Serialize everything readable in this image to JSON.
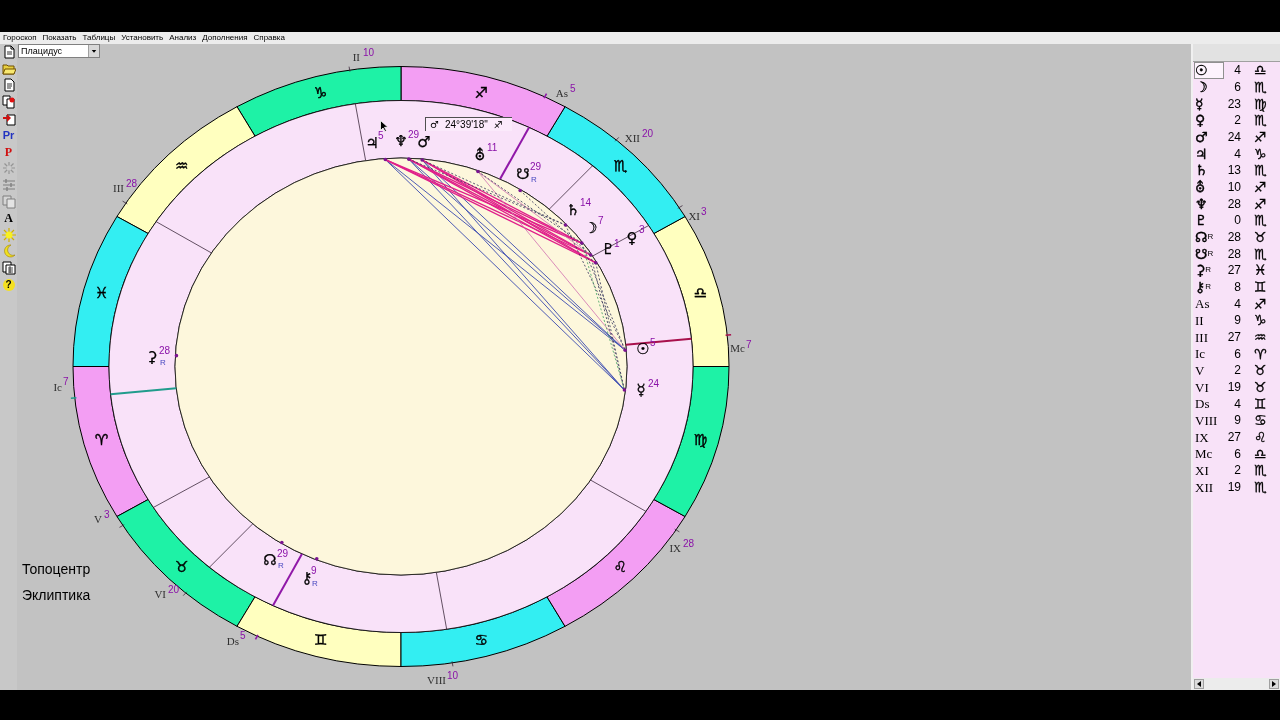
{
  "menu": [
    "Гороскоп",
    "Показать",
    "Таблицы",
    "Установить",
    "Анализ",
    "Дополнения",
    "Справка"
  ],
  "house_system": {
    "value": "Плацидус"
  },
  "toolbar": [
    {
      "kind": "icon",
      "disabled": false
    },
    {
      "kind": "icon",
      "disabled": false
    },
    {
      "kind": "icon",
      "disabled": false
    },
    {
      "kind": "icon",
      "disabled": false
    },
    {
      "kind": "icon",
      "disabled": false
    },
    {
      "kind": "text",
      "label": "Pr",
      "disabled": false
    },
    {
      "kind": "text",
      "label": "P",
      "disabled": false
    },
    {
      "kind": "icon",
      "disabled": true
    },
    {
      "kind": "icon",
      "disabled": true
    },
    {
      "kind": "icon",
      "disabled": true
    },
    {
      "kind": "text",
      "label": "A",
      "disabled": false
    },
    {
      "kind": "icon",
      "disabled": false
    },
    {
      "kind": "icon",
      "disabled": false
    },
    {
      "kind": "icon",
      "disabled": false
    },
    {
      "kind": "text",
      "label": "?",
      "disabled": false
    }
  ],
  "wheel": {
    "signs": [
      {
        "glyph": "♈",
        "color": "#f39ef3"
      },
      {
        "glyph": "♉",
        "color": "#1ef2a6"
      },
      {
        "glyph": "♊",
        "color": "#ffffbf"
      },
      {
        "glyph": "♋",
        "color": "#33eef2"
      },
      {
        "glyph": "♌",
        "color": "#f39ef3"
      },
      {
        "glyph": "♍",
        "color": "#1ef2a6"
      },
      {
        "glyph": "♎",
        "color": "#ffffbf"
      },
      {
        "glyph": "♏",
        "color": "#33eef2"
      },
      {
        "glyph": "♐",
        "color": "#f39ef3"
      },
      {
        "glyph": "♑",
        "color": "#1ef2a6"
      },
      {
        "glyph": "♒",
        "color": "#ffffbf"
      },
      {
        "glyph": "♓",
        "color": "#33eef2"
      }
    ],
    "cusps": [
      {
        "kind": "angle",
        "label": "As",
        "degree": "5",
        "color": "#9018a8"
      },
      {
        "kind": "house",
        "label": "II",
        "degree": "10"
      },
      {
        "kind": "house",
        "label": "III",
        "degree": "28"
      },
      {
        "kind": "angle",
        "label": "Ic",
        "degree": "7",
        "color": "#209c8c"
      },
      {
        "kind": "house",
        "label": "V",
        "degree": "3"
      },
      {
        "kind": "house",
        "label": "VI",
        "degree": "20"
      },
      {
        "kind": "angle",
        "label": "Ds",
        "degree": "5",
        "color": "#9018a8"
      },
      {
        "kind": "house",
        "label": "VIII",
        "degree": "10"
      },
      {
        "kind": "house",
        "label": "IX",
        "degree": "28"
      },
      {
        "kind": "angle",
        "label": "Mc",
        "degree": "7",
        "color": "#a8104c"
      },
      {
        "kind": "house",
        "label": "XI",
        "degree": "3"
      },
      {
        "kind": "house",
        "label": "XII",
        "degree": "20"
      }
    ],
    "planets": [
      {
        "glyph": "♃",
        "degree": "5"
      },
      {
        "glyph": "♆",
        "degree": "29"
      },
      {
        "glyph": "♂"
      },
      {
        "glyph": "⛢",
        "degree": "11"
      },
      {
        "glyph": "☋",
        "degree": "29",
        "flag": "R"
      },
      {
        "glyph": "♄",
        "degree": "14"
      },
      {
        "glyph": "☽",
        "degree": "7"
      },
      {
        "glyph": "♇",
        "degree": "1"
      },
      {
        "glyph": "♀",
        "degree": "3"
      },
      {
        "glyph": "⚳",
        "degree": "28",
        "flag": "R"
      },
      {
        "glyph": "☉",
        "degree": "5"
      },
      {
        "glyph": "☿",
        "degree": "24"
      },
      {
        "glyph": "☊",
        "degree": "29",
        "flag": "R"
      },
      {
        "glyph": "⚷",
        "degree": "9",
        "flag": "R"
      }
    ],
    "tooltip": {
      "planet": "♂",
      "position": "24°39'18\"",
      "sign": "♐"
    }
  },
  "chart_settings": [
    "Топоцентр",
    "Эклиптика"
  ],
  "positions": [
    {
      "kind": "planet",
      "point": "☉",
      "degree": "4",
      "sign": "♎",
      "selected": true
    },
    {
      "kind": "planet",
      "point": "☽",
      "degree": "6",
      "sign": "♏",
      "selected": false
    },
    {
      "kind": "planet",
      "point": "☿",
      "degree": "23",
      "sign": "♍",
      "selected": false
    },
    {
      "kind": "planet",
      "point": "♀",
      "degree": "2",
      "sign": "♏",
      "selected": false
    },
    {
      "kind": "planet",
      "point": "♂",
      "degree": "24",
      "sign": "♐",
      "selected": false
    },
    {
      "kind": "planet",
      "point": "♃",
      "degree": "4",
      "sign": "♑",
      "selected": false
    },
    {
      "kind": "planet",
      "point": "♄",
      "degree": "13",
      "sign": "♏",
      "selected": false
    },
    {
      "kind": "planet",
      "point": "⛢",
      "degree": "10",
      "sign": "♐",
      "selected": false
    },
    {
      "kind": "planet",
      "point": "♆",
      "degree": "28",
      "sign": "♐",
      "selected": false
    },
    {
      "kind": "planet",
      "point": "♇",
      "degree": "0",
      "sign": "♏",
      "selected": false
    },
    {
      "kind": "planet",
      "point": "☊",
      "flag": "R",
      "degree": "28",
      "sign": "♉",
      "selected": false
    },
    {
      "kind": "planet",
      "point": "☋",
      "flag": "R",
      "degree": "28",
      "sign": "♏",
      "selected": false
    },
    {
      "kind": "planet",
      "point": "⚳",
      "flag": "R",
      "degree": "27",
      "sign": "♓",
      "selected": false
    },
    {
      "kind": "planet",
      "point": "⚷",
      "flag": "R",
      "degree": "8",
      "sign": "♊",
      "selected": false
    },
    {
      "kind": "cusp",
      "point": "As",
      "degree": "4",
      "sign": "♐",
      "selected": false
    },
    {
      "kind": "cusp",
      "point": "II",
      "degree": "9",
      "sign": "♑",
      "selected": false
    },
    {
      "kind": "cusp",
      "point": "III",
      "degree": "27",
      "sign": "♒",
      "selected": false
    },
    {
      "kind": "cusp",
      "point": "Ic",
      "degree": "6",
      "sign": "♈",
      "selected": false
    },
    {
      "kind": "cusp",
      "point": "V",
      "degree": "2",
      "sign": "♉",
      "selected": false
    },
    {
      "kind": "cusp",
      "point": "VI",
      "degree": "19",
      "sign": "♉",
      "selected": false
    },
    {
      "kind": "cusp",
      "point": "Ds",
      "degree": "4",
      "sign": "♊",
      "selected": false
    },
    {
      "kind": "cusp",
      "point": "VIII",
      "degree": "9",
      "sign": "♋",
      "selected": false
    },
    {
      "kind": "cusp",
      "point": "IX",
      "degree": "27",
      "sign": "♌",
      "selected": false
    },
    {
      "kind": "cusp",
      "point": "Mc",
      "degree": "6",
      "sign": "♎",
      "selected": false
    },
    {
      "kind": "cusp",
      "point": "XI",
      "degree": "2",
      "sign": "♏",
      "selected": false
    },
    {
      "kind": "cusp",
      "point": "XII",
      "degree": "19",
      "sign": "♏",
      "selected": false
    }
  ]
}
